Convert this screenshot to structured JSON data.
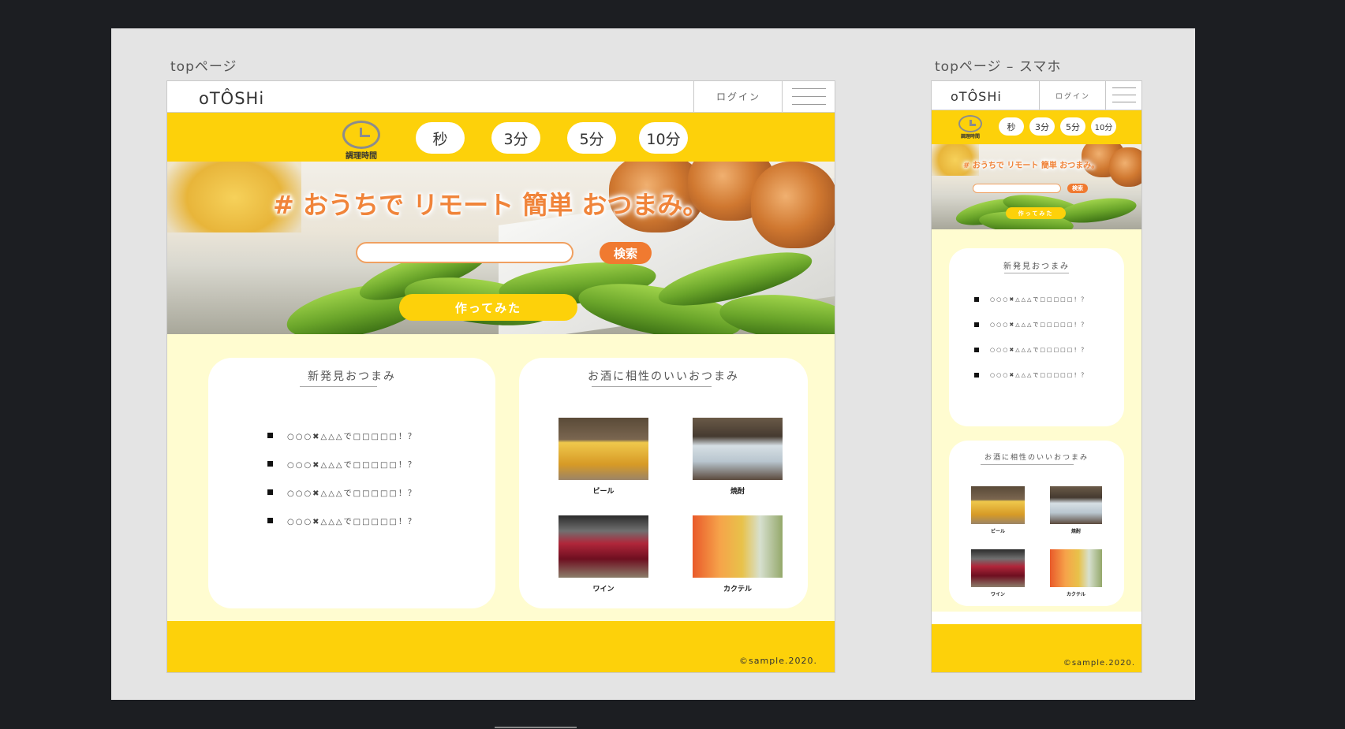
{
  "labels": {
    "desktop": "topページ",
    "mobile": "topページ – スマホ"
  },
  "header": {
    "logo": "oTÔSHi",
    "login": "ログイン",
    "menu_icon": "hamburger-icon"
  },
  "timebar": {
    "icon": "clock-icon",
    "caption": "調理時間",
    "options": [
      "秒",
      "3分",
      "5分",
      "10分"
    ]
  },
  "hero": {
    "title": "# おうちで リモート 簡単 おつまみ。",
    "search_value": "",
    "search_button": "検索",
    "cta_button": "作ってみた"
  },
  "new_finds": {
    "title": "新発見おつまみ",
    "items": [
      "○○○✖△△△で□□□□□！？",
      "○○○✖△△△で□□□□□！？",
      "○○○✖△△△で□□□□□！？",
      "○○○✖△△△で□□□□□！？"
    ]
  },
  "pairings": {
    "title": "お酒に相性のいいおつまみ",
    "drinks": [
      "ビール",
      "焼酎",
      "ワイン",
      "カクテル"
    ]
  },
  "footer": {
    "copyright": "©sample.2020."
  },
  "colors": {
    "yellow": "#fdd10a",
    "orange": "#f07a30",
    "cream": "#fffcd0"
  }
}
